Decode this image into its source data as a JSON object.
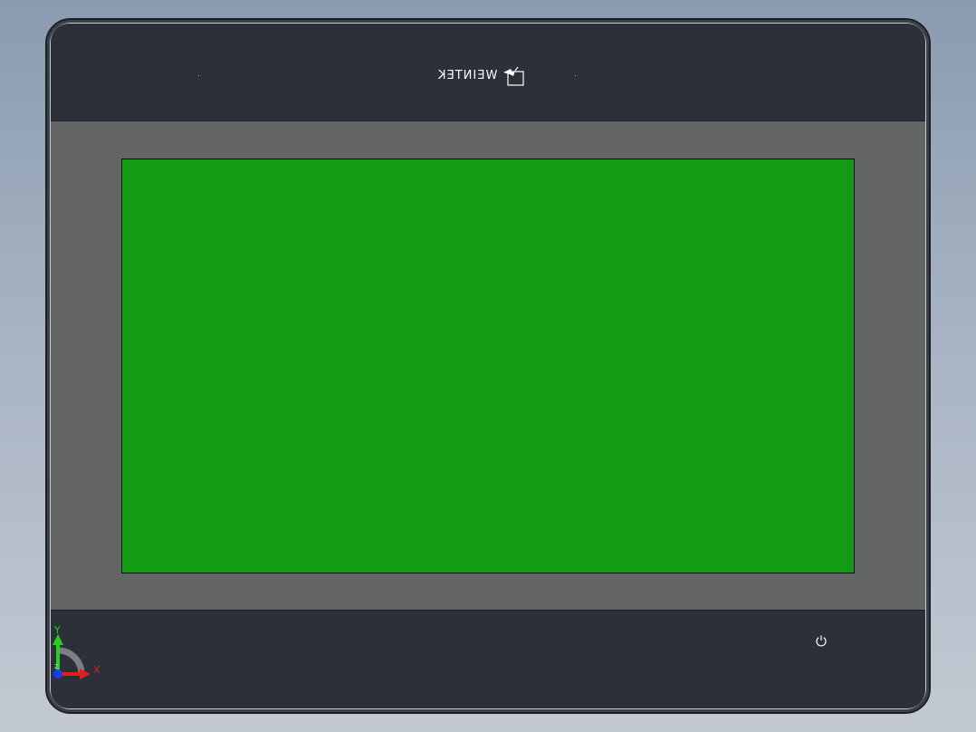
{
  "scene": {
    "type": "cad-3d-viewport",
    "model": "hmi-touch-panel-front-view"
  },
  "device": {
    "brand_text": "WEINTEK",
    "brand_logo_icon": "weintek-logo-icon",
    "power_icon": "power-icon",
    "colors": {
      "bezel": "#2c3038",
      "frame": "#626564",
      "screen": "#139c13",
      "background_top": "#8a9bb0",
      "background_bottom": "#c3c9d2"
    }
  },
  "triad": {
    "x_label": "X",
    "y_label": "Y",
    "z_label": "Z",
    "colors": {
      "x": "#e02020",
      "y": "#22d122",
      "z": "#1a3cf0"
    }
  }
}
